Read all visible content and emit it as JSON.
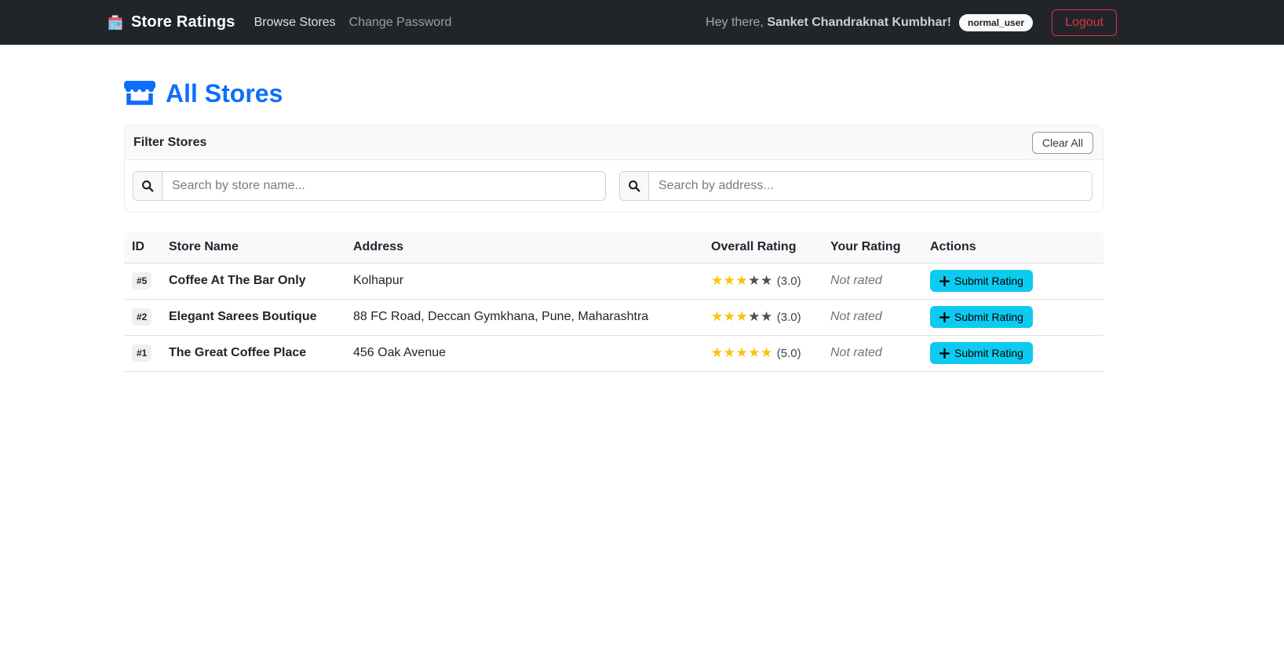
{
  "navbar": {
    "brand": "Store Ratings",
    "links": [
      {
        "label": "Browse Stores"
      },
      {
        "label": "Change Password"
      }
    ],
    "greeting_prefix": "Hey there, ",
    "user_name": "Sanket Chandraknat Kumbhar!",
    "role_badge": "normal_user",
    "logout_label": "Logout"
  },
  "page": {
    "title": "All Stores"
  },
  "filter": {
    "title": "Filter Stores",
    "clear_all_label": "Clear All",
    "name_placeholder": "Search by store name...",
    "name_value": "",
    "address_placeholder": "Search by address...",
    "address_value": ""
  },
  "table": {
    "headers": [
      "ID",
      "Store Name",
      "Address",
      "Overall Rating",
      "Your Rating",
      "Actions"
    ],
    "rows": [
      {
        "id": "#5",
        "name": "Coffee At The Bar Only",
        "address": "Kolhapur",
        "rating_stars": 3,
        "rating_label": "(3.0)",
        "your_rating": "Not rated",
        "action_label": "Submit Rating"
      },
      {
        "id": "#2",
        "name": "Elegant Sarees Boutique",
        "address": "88 FC Road, Deccan Gymkhana, Pune, Maharashtra",
        "rating_stars": 3,
        "rating_label": "(3.0)",
        "your_rating": "Not rated",
        "action_label": "Submit Rating"
      },
      {
        "id": "#1",
        "name": "The Great Coffee Place",
        "address": "456 Oak Avenue",
        "rating_stars": 5,
        "rating_label": "(5.0)",
        "your_rating": "Not rated",
        "action_label": "Submit Rating"
      }
    ],
    "stars_max": 5
  },
  "colors": {
    "navbar_bg": "#212529",
    "accent_blue": "#0d6efd",
    "star_filled": "#ffc107",
    "star_empty": "#495057",
    "info_cyan": "#0dcaf0",
    "danger_red": "#dc3545",
    "header_gray": "#f8f9fa"
  }
}
